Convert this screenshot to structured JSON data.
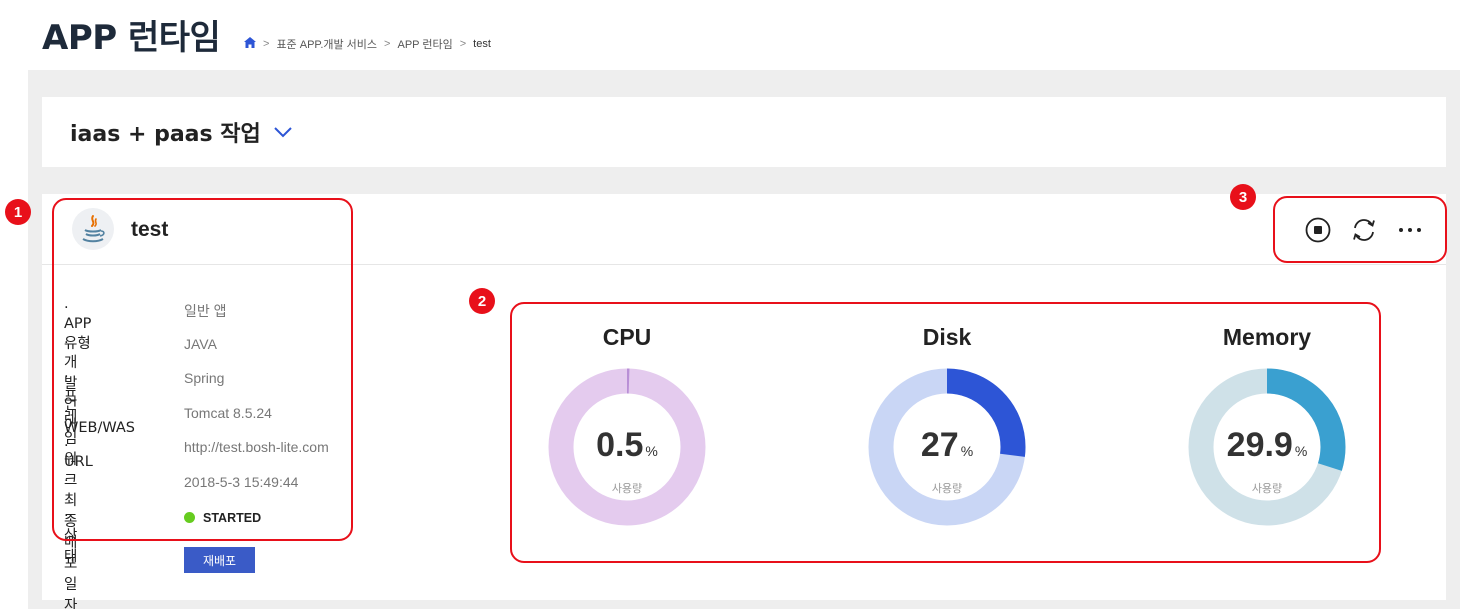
{
  "header": {
    "title": "APP 런타임",
    "breadcrumb": [
      "표준 APP.개발 서비스",
      "APP 런타임",
      "test"
    ],
    "breadcrumb_separator": ">"
  },
  "project": {
    "name": "iaas + paas 작업"
  },
  "app": {
    "name": "test",
    "icon": "java-icon",
    "info": [
      {
        "label": "· APP 유형",
        "value": "일반 앱"
      },
      {
        "label": "· 개발언어",
        "value": "JAVA"
      },
      {
        "label": "· 프레임워크",
        "value": "Spring"
      },
      {
        "label": "· WEB/WAS",
        "value": "Tomcat 8.5.24"
      },
      {
        "label": "· URL",
        "value": "http://test.bosh-lite.com"
      },
      {
        "label": "· 최종 배포일자",
        "value": "2018-5-3 15:49:44"
      },
      {
        "label": "· 상태",
        "value": "STARTED"
      }
    ],
    "status_color": "#66cc1f",
    "redeploy_label": "재배포"
  },
  "actions": [
    "stop-icon",
    "restart-icon",
    "more-icon"
  ],
  "gauges": [
    {
      "title": "CPU",
      "value": "0.5",
      "percent": 0.5,
      "unit": "%",
      "sub": "사용량",
      "track_color": "#e4cbee",
      "fill_color": "#b98fd6"
    },
    {
      "title": "Disk",
      "value": "27",
      "percent": 27,
      "unit": "%",
      "sub": "사용량",
      "track_color": "#c9d6f5",
      "fill_color": "#2d55d6"
    },
    {
      "title": "Memory",
      "value": "29.9",
      "percent": 29.9,
      "unit": "%",
      "sub": "사용량",
      "track_color": "#cfe1e8",
      "fill_color": "#3aa0d0"
    }
  ],
  "annotations": [
    "1",
    "2",
    "3"
  ],
  "annotation_color": "#e8101a"
}
